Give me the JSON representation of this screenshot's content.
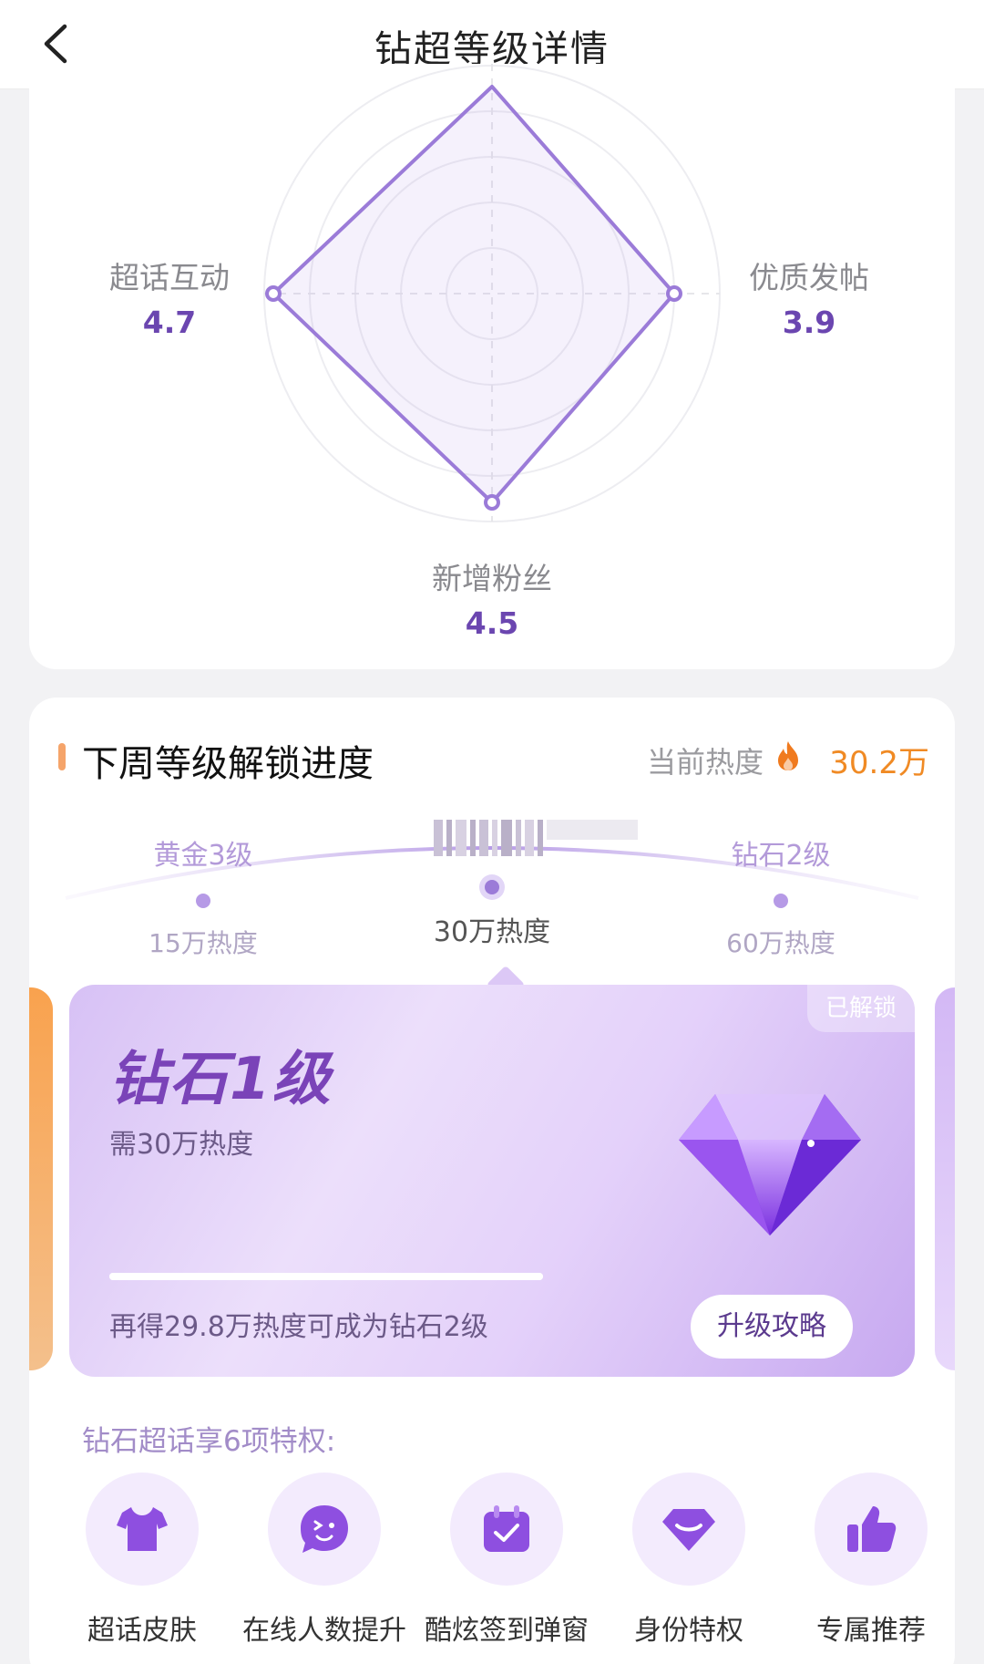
{
  "header": {
    "title": "钻超等级详情"
  },
  "radar": {
    "axes": [
      {
        "name": "超话互动",
        "value": "4.7"
      },
      {
        "name": "优质发帖",
        "value": "3.9"
      },
      {
        "name": "新增粉丝",
        "value": "4.5"
      }
    ]
  },
  "progress": {
    "section_title": "下周等级解锁进度",
    "heat_label": "当前热度",
    "heat_value": "30.2万",
    "levels": [
      {
        "name": "黄金3级",
        "heat": "15万热度"
      },
      {
        "name": "",
        "heat": "30万热度"
      },
      {
        "name": "钻石2级",
        "heat": "60万热度"
      }
    ],
    "card": {
      "tag": "已解锁",
      "level_name": "钻石1级",
      "requirement": "需30万热度",
      "progress_fraction": 1.0,
      "tip": "再得29.8万热度可成为钻石2级",
      "button": "升级攻略"
    },
    "perks_title": "钻石超话享6项特权:",
    "perks": [
      {
        "label": "超话皮肤",
        "icon": "shirt-icon"
      },
      {
        "label": "在线人数提升",
        "icon": "smiley-icon"
      },
      {
        "label": "酷炫签到弹窗",
        "icon": "calendar-check-icon"
      },
      {
        "label": "身份特权",
        "icon": "diamond-badge-icon"
      },
      {
        "label": "专属推荐",
        "icon": "thumbs-up-icon"
      }
    ]
  },
  "colors": {
    "accent": "#7a43b8",
    "heat": "#f08a24",
    "purple_light": "#b39ad9"
  }
}
